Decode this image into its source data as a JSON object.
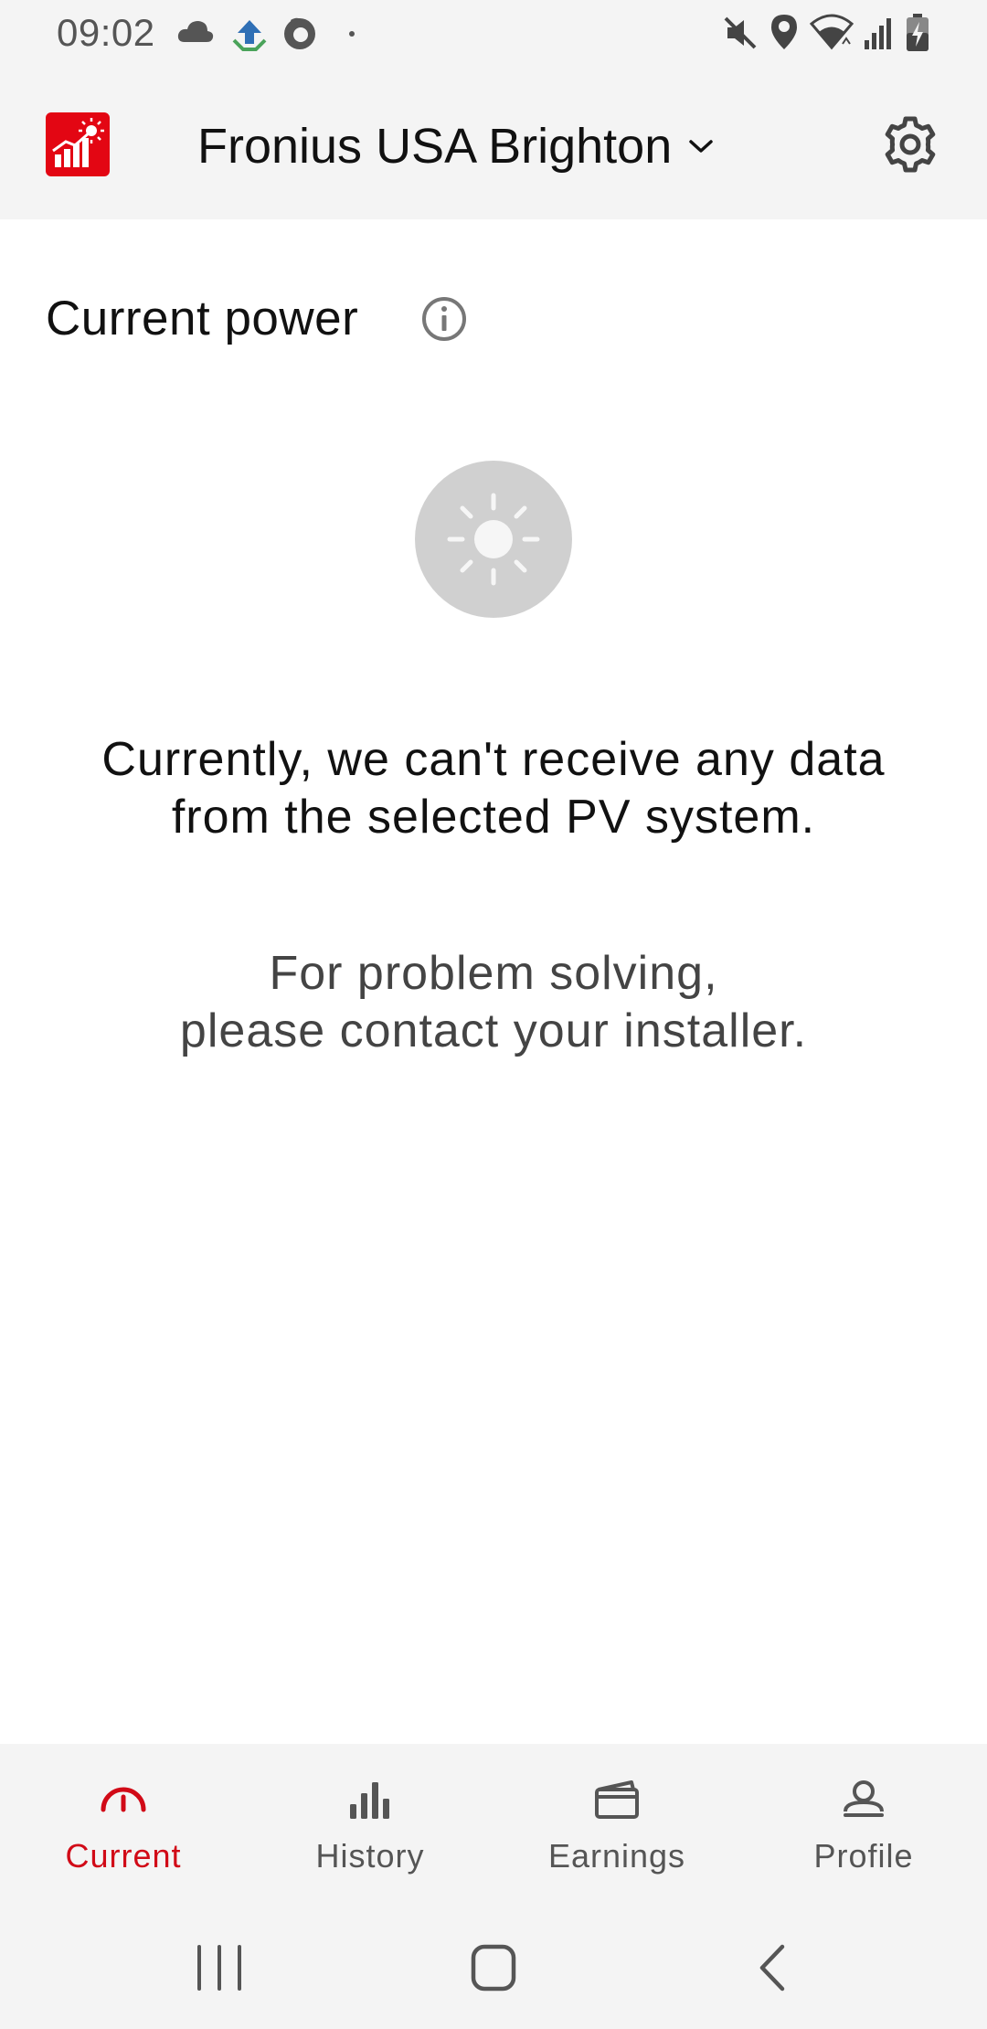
{
  "status_bar": {
    "time": "09:02",
    "icons": [
      "cloud-icon",
      "app-notification-icon",
      "firefox-icon",
      "dot-icon",
      "mute-icon",
      "location-icon",
      "wifi-icon",
      "signal-icon",
      "battery-charging-icon"
    ]
  },
  "header": {
    "site_name": "Fronius USA Brighton",
    "logo_icon": "fronius-solarweb-logo",
    "settings_icon": "gear-icon"
  },
  "main": {
    "section_title": "Current power",
    "info_icon": "info-icon",
    "status_icon": "sun-icon",
    "message_primary_line1": "Currently, we can't receive any data",
    "message_primary_line2": "from the selected PV system.",
    "message_secondary_line1": "For problem solving,",
    "message_secondary_line2": "please contact your installer."
  },
  "bottom_nav": {
    "items": [
      {
        "label": "Current",
        "icon": "gauge-icon",
        "active": true
      },
      {
        "label": "History",
        "icon": "bar-chart-icon",
        "active": false
      },
      {
        "label": "Earnings",
        "icon": "wallet-icon",
        "active": false
      },
      {
        "label": "Profile",
        "icon": "person-icon",
        "active": false
      }
    ]
  },
  "system_nav": {
    "buttons": [
      "recent-apps-icon",
      "home-icon",
      "back-icon"
    ]
  },
  "colors": {
    "accent": "#d10a17",
    "logo_red": "#e30613",
    "header_bg": "#f4f4f4",
    "content_bg": "#ffffff",
    "sun_circle": "#d0d0d0"
  }
}
